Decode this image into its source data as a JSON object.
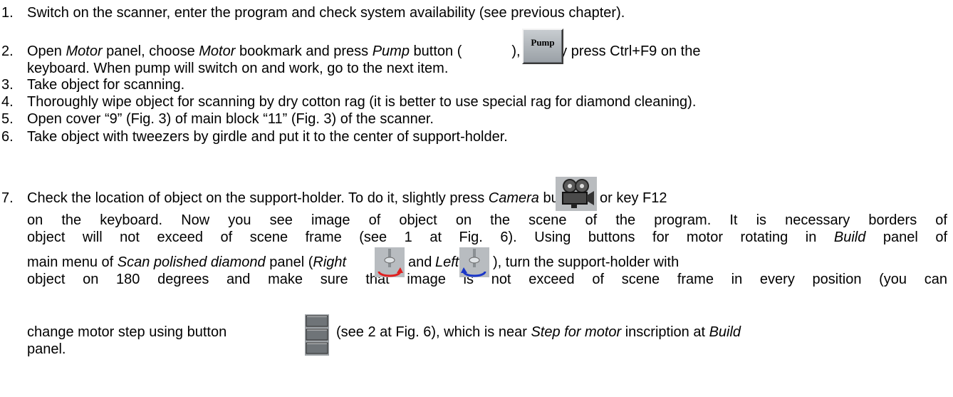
{
  "steps": [
    {
      "num": "1.",
      "parts": [
        "Switch on the scanner, enter the program and check system availability (see previous chapter)."
      ]
    },
    {
      "num": "2.",
      "parts": [
        "Open ",
        "Motor",
        " panel, choose ",
        "Motor",
        " bookmark and press ",
        "Pump",
        " button (",
        "), or only press Ctrl+F9 on the",
        "keyboard. When pump will switch on and work, go to the next item."
      ]
    },
    {
      "num": "3.",
      "parts": [
        "Take object for scanning."
      ]
    },
    {
      "num": "4.",
      "parts": [
        "Thoroughly wipe object for scanning by dry cotton rag (it is better to use special rag for diamond cleaning)."
      ]
    },
    {
      "num": "5.",
      "parts": [
        "Open cover “9” (Fig. 3) of main block “11” (Fig. 3) of the scanner."
      ]
    },
    {
      "num": "6.",
      "parts": [
        "Take object with tweezers by girdle and put it to the center of support-holder."
      ]
    },
    {
      "num": "7.",
      "parts": [
        "Check the location of object on the support-holder. To do it, slightly press ",
        "Camera",
        " button",
        "or key F12",
        "on the keyboard. Now you see image of object on the scene of the program. It is necessary borders of",
        "object will not exceed of scene frame (see 1 at Fig. 6). Using buttons for motor rotating in ",
        "Build",
        " panel of",
        "main menu of ",
        "Scan polished diamond",
        " panel (",
        "Right",
        "and ",
        "Left",
        "), turn the support-holder with",
        "object on 180 degrees and make sure that image is not exceed of scene frame in every position (you can",
        "change motor step using  button",
        "(see 2 at Fig. 6), which is near ",
        "Step for motor",
        " inscription at ",
        "Build",
        "panel."
      ]
    }
  ],
  "icons": {
    "pump_button_label": "Pump",
    "camera": "camera-icon",
    "right": "rotate-right-icon",
    "left": "rotate-left-icon",
    "step": "step-selector-icon"
  }
}
